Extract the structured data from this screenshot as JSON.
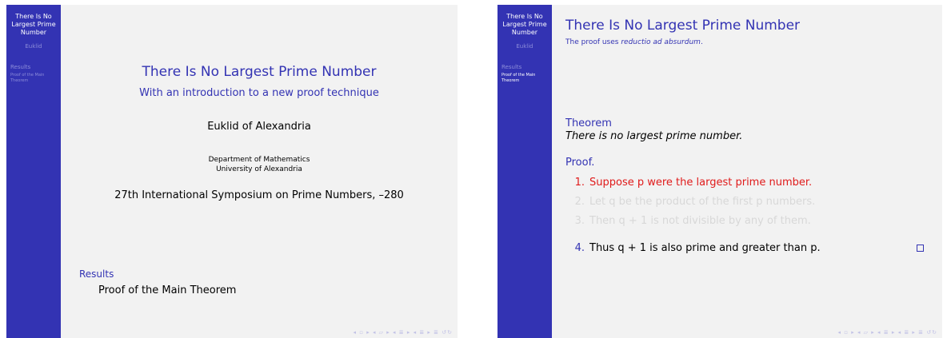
{
  "sidebar": {
    "title": "There Is No Largest Prime Number",
    "author": "Euklid",
    "section": "Results",
    "subsection": "Proof of the Main Theorem"
  },
  "title_slide": {
    "title": "There Is No Largest Prime Number",
    "subtitle": "With an introduction to a new proof technique",
    "author": "Euklid of Alexandria",
    "institute_line1": "Department of Mathematics",
    "institute_line2": "University of Alexandria",
    "date": "27th International Symposium on Prime Numbers, –280",
    "toc_section": "Results",
    "toc_subsection": "Proof of the Main Theorem"
  },
  "proof_slide": {
    "frame_title": "There Is No Largest Prime Number",
    "frame_subtitle_prefix": "The proof uses ",
    "frame_subtitle_emph": "reductio ad absurdum",
    "frame_subtitle_suffix": ".",
    "theorem_heading": "Theorem",
    "theorem_body": "There is no largest prime number.",
    "proof_heading": "Proof.",
    "steps": [
      {
        "number": "1.",
        "text": "Suppose p were the largest prime number."
      },
      {
        "number": "2.",
        "text": "Let q be the product of the first p numbers."
      },
      {
        "number": "3.",
        "text": "Then q + 1 is not divisible by any of them."
      },
      {
        "number": "4.",
        "text": "Thus q + 1 is also prime and greater than p."
      }
    ]
  },
  "nav_symbols": "◂ ▫ ▸ ◂ ▱ ▸ ◂ ≣ ▸ ◂ ≣ ▸ ≣ ↺↻"
}
